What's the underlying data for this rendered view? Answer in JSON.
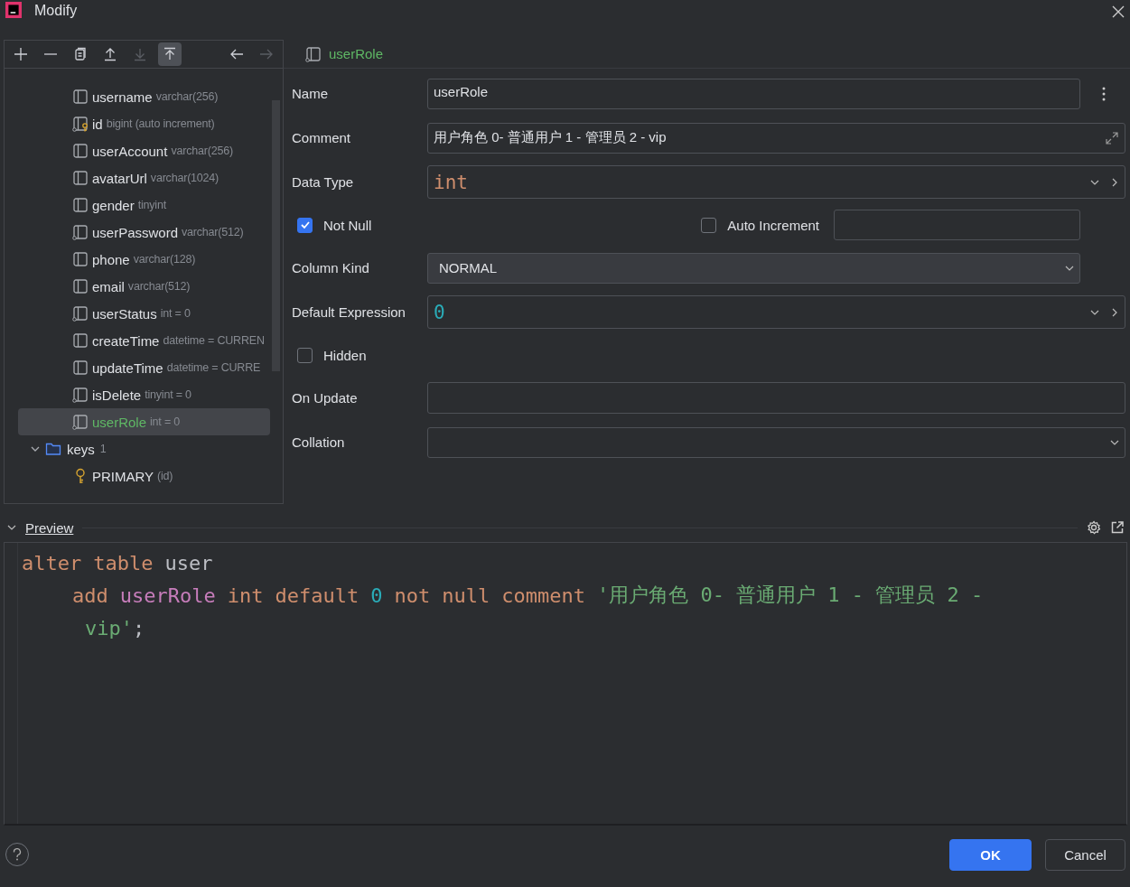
{
  "window": {
    "title": "Modify"
  },
  "toolbar": [
    {
      "kind": "plus",
      "disabled": false,
      "selected": false
    },
    {
      "kind": "minus",
      "disabled": false,
      "selected": false
    },
    {
      "kind": "copy",
      "disabled": false,
      "selected": false
    },
    {
      "kind": "up",
      "disabled": false,
      "selected": false
    },
    {
      "kind": "down",
      "disabled": true,
      "selected": false
    },
    {
      "kind": "top",
      "disabled": false,
      "selected": true
    },
    {
      "kind": "back",
      "disabled": false,
      "selected": false
    },
    {
      "kind": "forward",
      "disabled": true,
      "selected": false
    }
  ],
  "tree": {
    "columns": [
      {
        "name": "username",
        "type": "varchar(256)",
        "kind": "column",
        "selected": false
      },
      {
        "name": "id",
        "type": "bigint (auto increment)",
        "kind": "key",
        "selected": false
      },
      {
        "name": "userAccount",
        "type": "varchar(256)",
        "kind": "column",
        "selected": false
      },
      {
        "name": "avatarUrl",
        "type": "varchar(1024)",
        "kind": "column",
        "selected": false
      },
      {
        "name": "gender",
        "type": "tinyint",
        "kind": "column",
        "selected": false
      },
      {
        "name": "userPassword",
        "type": "varchar(512)",
        "kind": "notnull",
        "selected": false
      },
      {
        "name": "phone",
        "type": "varchar(128)",
        "kind": "column",
        "selected": false
      },
      {
        "name": "email",
        "type": "varchar(512)",
        "kind": "column",
        "selected": false
      },
      {
        "name": "userStatus",
        "type": "int = 0",
        "kind": "notnull",
        "selected": false
      },
      {
        "name": "createTime",
        "type": "datetime = CURREN",
        "kind": "column",
        "selected": false
      },
      {
        "name": "updateTime",
        "type": "datetime = CURRE",
        "kind": "column",
        "selected": false
      },
      {
        "name": "isDelete",
        "type": "tinyint = 0",
        "kind": "notnull",
        "selected": false
      },
      {
        "name": "userRole",
        "type": "int = 0",
        "kind": "notnull",
        "selected": true
      }
    ],
    "keys": {
      "label": "keys",
      "count": "1",
      "expanded": true,
      "children": [
        {
          "name": "PRIMARY",
          "detail": "(id)"
        }
      ]
    }
  },
  "editor": {
    "header": "userRole",
    "name": {
      "label": "Name",
      "value": "userRole"
    },
    "comment": {
      "label": "Comment",
      "value": "用户角色 0- 普通用户 1 - 管理员 2 - vip"
    },
    "data_type": {
      "label": "Data Type",
      "value": "int"
    },
    "not_null": {
      "label": "Not Null",
      "checked": true
    },
    "auto_increment": {
      "label": "Auto Increment",
      "checked": false
    },
    "column_kind": {
      "label": "Column Kind",
      "value": "NORMAL"
    },
    "default_expression": {
      "label": "Default Expression",
      "value": "0"
    },
    "hidden": {
      "label": "Hidden",
      "checked": false
    },
    "on_update": {
      "label": "On Update"
    },
    "collation": {
      "label": "Collation"
    }
  },
  "preview": {
    "title": "Preview",
    "expanded": true,
    "lines": [
      {
        "kind": "statement",
        "tokens": [
          {
            "text": "alter",
            "kind": "keyword"
          },
          {
            "text": "table",
            "kind": "keyword"
          },
          {
            "text": "user",
            "kind": "plain"
          }
        ]
      },
      {
        "kind": "clause",
        "tokens": [
          {
            "text": "add",
            "kind": "keyword"
          },
          {
            "text": "userRole",
            "kind": "ident"
          },
          {
            "text": "int",
            "kind": "keyword"
          },
          {
            "text": "default",
            "kind": "keyword"
          },
          {
            "text": "0",
            "kind": "number"
          },
          {
            "text": "not",
            "kind": "keyword"
          },
          {
            "text": "null",
            "kind": "keyword"
          },
          {
            "text": "comment",
            "kind": "keyword"
          },
          {
            "text": "'用户角色 0- 普通用户 1 - 管理员 2 -",
            "kind": "string"
          }
        ]
      },
      {
        "kind": "wrapped",
        "tokens": [
          {
            "text": "vip'",
            "kind": "string"
          },
          {
            "text": ";",
            "kind": "plain"
          }
        ]
      }
    ]
  },
  "buttons": [
    {
      "label": "OK",
      "kind": "primary"
    },
    {
      "label": "Cancel",
      "kind": "secondary"
    }
  ]
}
